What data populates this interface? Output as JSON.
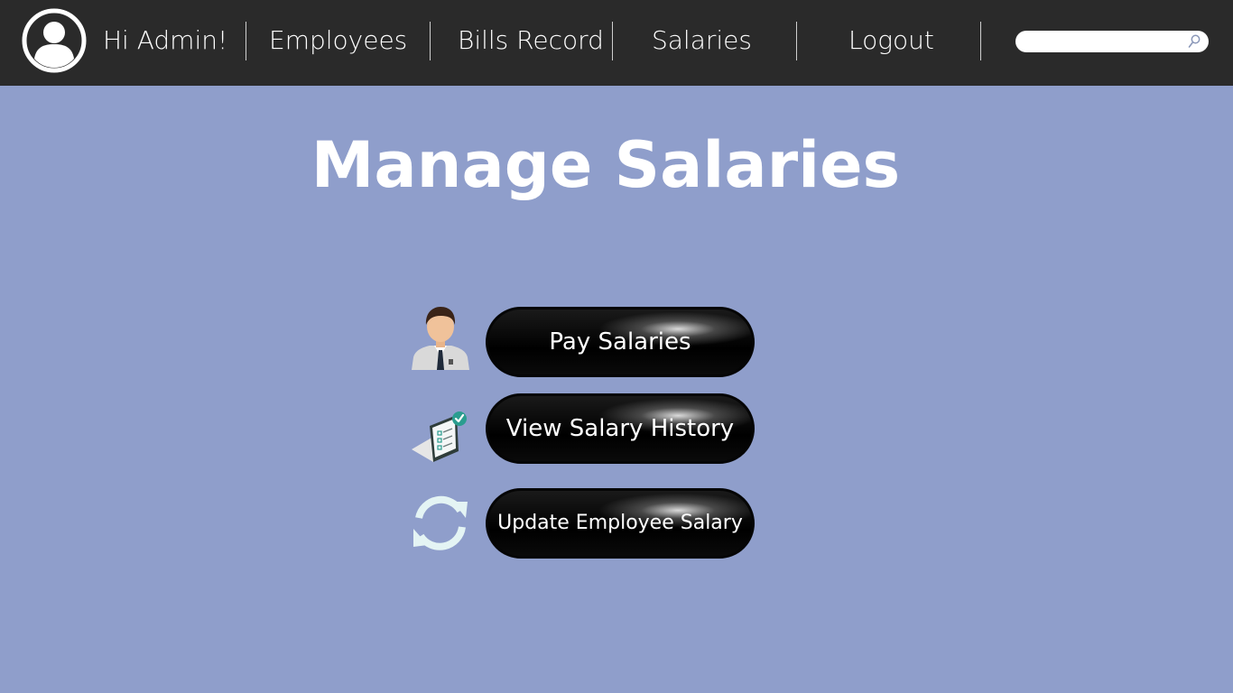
{
  "header": {
    "greeting": "Hi Admin!",
    "nav": [
      {
        "label": "Employees"
      },
      {
        "label": "Bills Record"
      },
      {
        "label": "Salaries"
      },
      {
        "label": "Logout"
      }
    ],
    "search": {
      "value": "",
      "placeholder": ""
    }
  },
  "main": {
    "title": "Manage Salaries",
    "actions": [
      {
        "label": "Pay Salaries",
        "icon": "employee-icon"
      },
      {
        "label": "View Salary History",
        "icon": "checklist-icon"
      },
      {
        "label": "Update Employee Salary",
        "icon": "refresh-icon"
      }
    ]
  },
  "colors": {
    "background": "#8f9ecb",
    "navbar": "#2a2a2a",
    "button": "#000000",
    "text": "#ffffff",
    "accent": "#2a9d8f"
  }
}
